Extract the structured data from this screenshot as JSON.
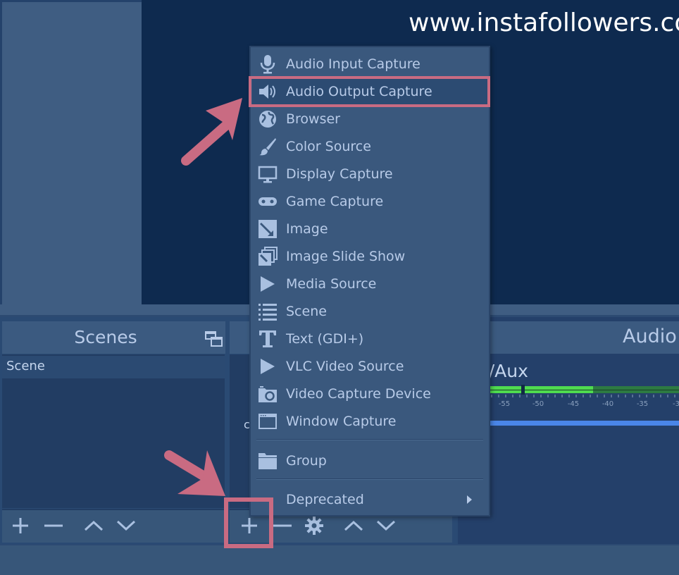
{
  "watermark": "www.instafollowers.co",
  "scenes": {
    "title": "Scenes",
    "items": [
      "Scene"
    ],
    "toolbar": [
      {
        "name": "add-scene-button",
        "icon": "plus-icon"
      },
      {
        "name": "remove-scene-button",
        "icon": "minus-icon"
      },
      {
        "name": "move-scene-up-button",
        "icon": "chevron-up-icon"
      },
      {
        "name": "move-scene-down-button",
        "icon": "chevron-down-icon"
      }
    ]
  },
  "sources": {
    "partial_text": "c",
    "toolbar": [
      {
        "name": "add-source-button",
        "icon": "plus-icon"
      },
      {
        "name": "remove-source-button",
        "icon": "minus-icon"
      },
      {
        "name": "source-properties-button",
        "icon": "gear-icon"
      },
      {
        "name": "move-source-up-button",
        "icon": "chevron-up-icon"
      },
      {
        "name": "move-source-down-button",
        "icon": "chevron-down-icon"
      }
    ]
  },
  "audio": {
    "title": "Audio",
    "track_name": "c/Aux",
    "meter_ticks": [
      "-55",
      "-50",
      "-45",
      "-40",
      "-35",
      "-3"
    ]
  },
  "context_menu": {
    "items": [
      {
        "label": "Audio Input Capture",
        "icon": "microphone-icon"
      },
      {
        "label": "Audio Output Capture",
        "icon": "speaker-icon",
        "highlighted": true
      },
      {
        "label": "Browser",
        "icon": "globe-icon"
      },
      {
        "label": "Color Source",
        "icon": "paintbrush-icon"
      },
      {
        "label": "Display Capture",
        "icon": "monitor-icon"
      },
      {
        "label": "Game Capture",
        "icon": "gamepad-icon"
      },
      {
        "label": "Image",
        "icon": "image-icon"
      },
      {
        "label": "Image Slide Show",
        "icon": "slideshow-icon"
      },
      {
        "label": "Media Source",
        "icon": "play-icon"
      },
      {
        "label": "Scene",
        "icon": "list-icon"
      },
      {
        "label": "Text (GDI+)",
        "icon": "text-icon"
      },
      {
        "label": "VLC Video Source",
        "icon": "play-icon"
      },
      {
        "label": "Video Capture Device",
        "icon": "camera-icon"
      },
      {
        "label": "Window Capture",
        "icon": "window-icon"
      },
      {
        "label": "Group",
        "icon": "folder-icon"
      },
      {
        "label": "Deprecated",
        "icon": "",
        "submenu": true
      }
    ]
  },
  "colors": {
    "annotation": "#c96b82",
    "menu_bg": "#3a587d",
    "preview_bg": "#0e2a4f",
    "meter_green": "#4fdb4f",
    "volume_blue": "#4a86e8"
  }
}
